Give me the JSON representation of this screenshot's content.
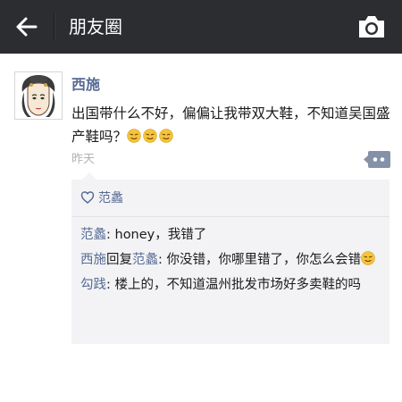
{
  "header": {
    "title": "朋友圈",
    "back_icon": "arrow-left-icon",
    "camera_icon": "camera-icon"
  },
  "post": {
    "author": "西施",
    "content": "出国带什么不好，偏偏让我带双大鞋，不知道吴国盛产鞋吗？",
    "emoji_icon": "sly-face-emoji",
    "time": "昨天",
    "more_icon": "comment-more-icon"
  },
  "likes": {
    "heart_icon": "heart-outline-icon",
    "names": "范蠡"
  },
  "comments": [
    {
      "author": "范蠡",
      "sep": ": ",
      "text": "honey，我错了"
    },
    {
      "author": "西施",
      "reply_word": "回复",
      "target": "范蠡",
      "sep": ": ",
      "text": "你没错，你哪里错了，你怎么会错"
    },
    {
      "author": "勾践",
      "sep": ": ",
      "text": "楼上的，不知道温州批发市场好多卖鞋的吗"
    }
  ],
  "colors": {
    "topbar": "#2b2d31",
    "link": "#576b95",
    "panel": "#f3f3f5",
    "time": "#b2b2b2"
  }
}
